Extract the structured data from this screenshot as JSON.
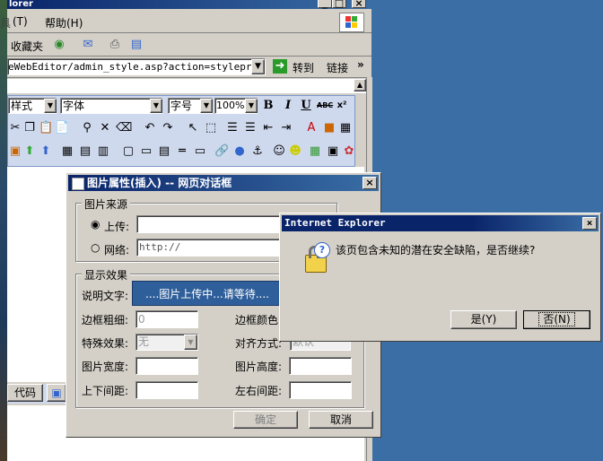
{
  "ie_window": {
    "title_fragment": "lorer",
    "menu": [
      "(T)",
      "帮助(H)"
    ],
    "menu_prefix": "具",
    "links_toolbar": [
      "收藏夹"
    ],
    "address": "eWebEditor/admin_style.asp?action=stylepreview",
    "go_label": "转到",
    "links_label": "链接",
    "chevron": "»"
  },
  "editor_toolbar": {
    "style_select": "样式",
    "font_select": "字体",
    "size_select": "字号",
    "zoom_select": "100%",
    "bold": "B",
    "italic": "I",
    "underline": "U",
    "strike": "ABC",
    "superscript": "x²"
  },
  "editor_bottom": {
    "code_tab": "代码"
  },
  "img_dialog": {
    "title": "图片属性(插入) -- 网页对话框",
    "source_group": "图片来源",
    "upload_label": "上传:",
    "web_label": "网络:",
    "web_value": "http://",
    "effects_group": "显示效果",
    "desc_label": "说明文字:",
    "uploading_text": "....图片上传中...请等待....",
    "border_width_label": "边框粗细:",
    "border_width_value": "0",
    "border_color_label": "边框颜色",
    "special_label": "特殊效果:",
    "special_value": "无",
    "align_label": "对齐方式:",
    "align_value": "默认",
    "img_width_label": "图片宽度:",
    "img_height_label": "图片高度:",
    "vspace_label": "上下间距:",
    "hspace_label": "左右间距:",
    "ok_label": "确定",
    "cancel_label": "取消"
  },
  "alert_dialog": {
    "title": "Internet Explorer",
    "message": "该页包含未知的潜在安全缺陷，是否继续?",
    "yes_label": "是(Y)",
    "no_label": "否(N)"
  },
  "colors": {
    "desktop": "#3a6ea5",
    "title_start": "#0a246a",
    "title_end": "#3a6ea5",
    "face": "#d4d0c8",
    "uploading_bg": "#2f5f9a"
  }
}
